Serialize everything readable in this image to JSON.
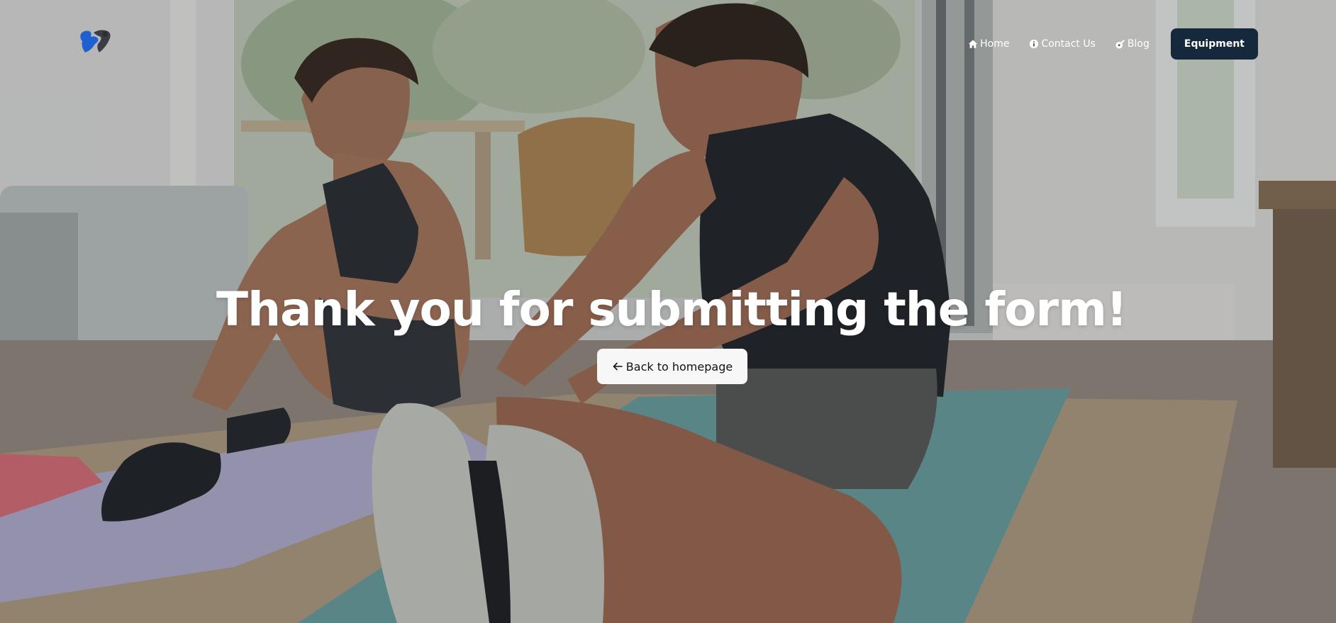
{
  "header": {
    "logo_icon": "flexing-arm-logo-icon"
  },
  "nav": {
    "items": [
      {
        "label": "Home",
        "icon": "home-icon"
      },
      {
        "label": "Contact Us",
        "icon": "info-icon"
      },
      {
        "label": "Blog",
        "icon": "blog-icon"
      }
    ],
    "cta_label": "Equipment",
    "cta_color": "#16293c"
  },
  "main": {
    "headline": "Thank you for submitting the form!",
    "back_button_label": "Back to homepage",
    "back_button_icon": "arrow-left-icon"
  }
}
